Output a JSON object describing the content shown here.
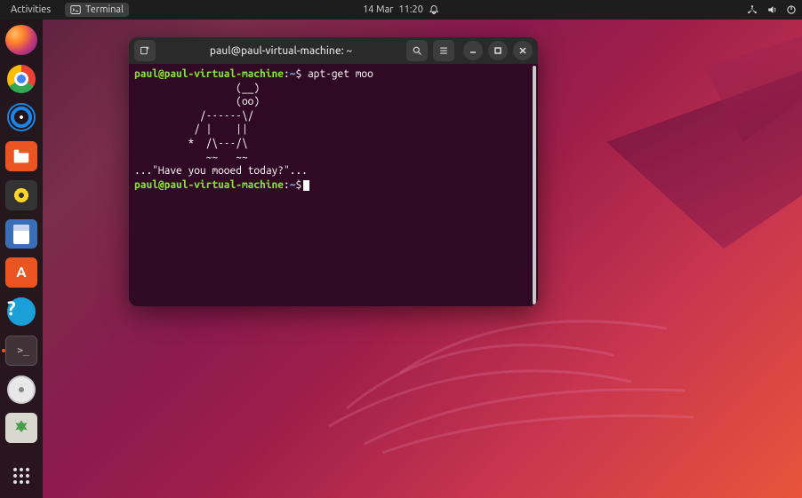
{
  "top_panel": {
    "activities": "Activities",
    "app_indicator": "Terminal",
    "date": "14 Mar",
    "time": "11:20"
  },
  "dock": {
    "items": [
      {
        "name": "firefox"
      },
      {
        "name": "chrome"
      },
      {
        "name": "coach"
      },
      {
        "name": "files"
      },
      {
        "name": "rhythmbox"
      },
      {
        "name": "libreoffice-writer"
      },
      {
        "name": "ubuntu-software"
      },
      {
        "name": "help"
      },
      {
        "name": "terminal"
      },
      {
        "name": "disc"
      },
      {
        "name": "trash"
      }
    ],
    "show_apps": "Show Applications"
  },
  "terminal": {
    "title": "paul@paul-virtual-machine: ~",
    "prompt": {
      "user_host": "paul@paul-virtual-machine",
      "sep": ":",
      "path": "~",
      "symbol": "$"
    },
    "command": "apt-get moo",
    "output_lines": [
      "                 (__) ",
      "                 (oo) ",
      "           /------\\/ ",
      "          / |    ||   ",
      "         *  /\\---/\\ ",
      "            ~~   ~~   ",
      "...\"Have you mooed today?\"..."
    ]
  }
}
